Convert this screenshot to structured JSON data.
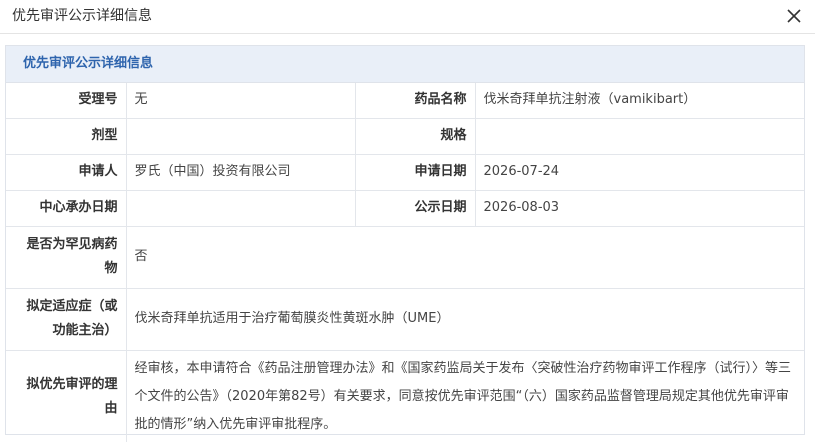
{
  "dialog": {
    "title": "优先审评公示详细信息",
    "close_icon": "close-icon"
  },
  "panel": {
    "heading": "优先审评公示详细信息"
  },
  "fields": {
    "accept_no_label": "受理号",
    "accept_no_value": "无",
    "drug_name_label": "药品名称",
    "drug_name_value": "伐米奇拜单抗注射液（vamikibart）",
    "dosage_form_label": "剂型",
    "dosage_form_value": "",
    "spec_label": "规格",
    "spec_value": "",
    "applicant_label": "申请人",
    "applicant_value": "罗氏（中国）投资有限公司",
    "apply_date_label": "申请日期",
    "apply_date_value": "2026-07-24",
    "center_date_label": "中心承办日期",
    "center_date_value": "",
    "publish_date_label": "公示日期",
    "publish_date_value": "2026-08-03",
    "rare_label": "是否为罕见病药物",
    "rare_value": "否",
    "indication_label": "拟定适应症（或功能主治）",
    "indication_value": "伐米奇拜单抗适用于治疗葡萄膜炎性黄斑水肿（UME）",
    "reason_label": "拟优先审评的理由",
    "reason_value": "经审核，本申请符合《药品注册管理办法》和《国家药监局关于发布〈突破性治疗药物审评工作程序（试行）〉等三个文件的公告》（2020年第82号）有关要求，同意按优先审评范围“（六）国家药品监督管理局规定其他优先审评审批的情形”纳入优先审评审批程序。"
  }
}
